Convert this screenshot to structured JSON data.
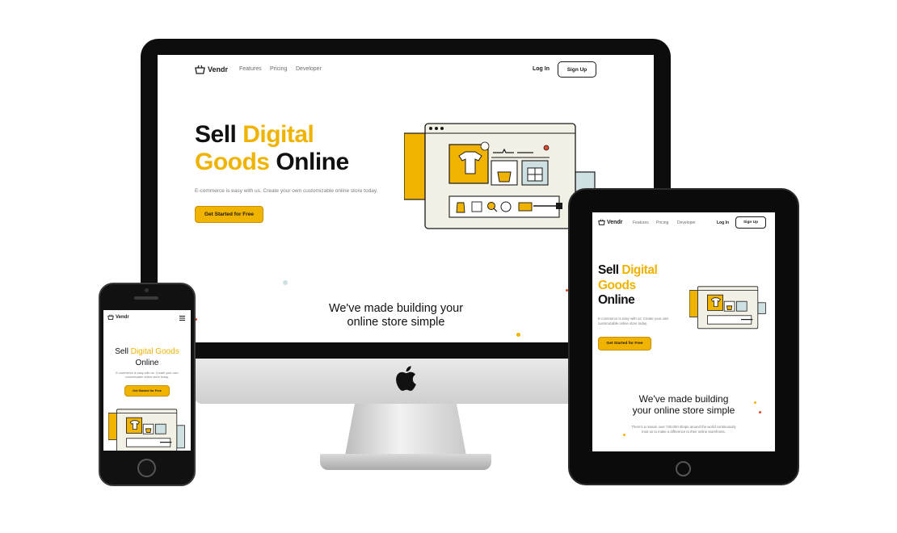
{
  "brand": "Vendr",
  "nav": {
    "links": [
      "Features",
      "Pricing",
      "Developer"
    ],
    "login": "Log In",
    "signup": "Sign Up"
  },
  "hero": {
    "title_part1": "Sell ",
    "title_highlight": "Digital",
    "title_part2_highlight": "Goods",
    "title_part3": " Online",
    "tablet_highlight": "Digital Goods",
    "mobile_highlight": "Digital Goods",
    "online": "Online",
    "sell": "Sell",
    "subtitle": "E-commerce is easy with us. Create your own customizable online store today.",
    "cta": "Get Started for Free"
  },
  "section": {
    "line1": "We've made building your",
    "line2": "online store simple",
    "tablet_line1": "We've made building",
    "tablet_line2": "your online store simple",
    "body": "There's a reason over 700,000 shops around the world continuously trust us to make a difference to their online storefronts."
  },
  "menu_icon": "hamburger-icon",
  "colors": {
    "accent": "#f0b300",
    "device_black": "#0d0d0d",
    "illustration_bg": "#f3f0e6",
    "illustration_teal": "#cfe0e3"
  }
}
